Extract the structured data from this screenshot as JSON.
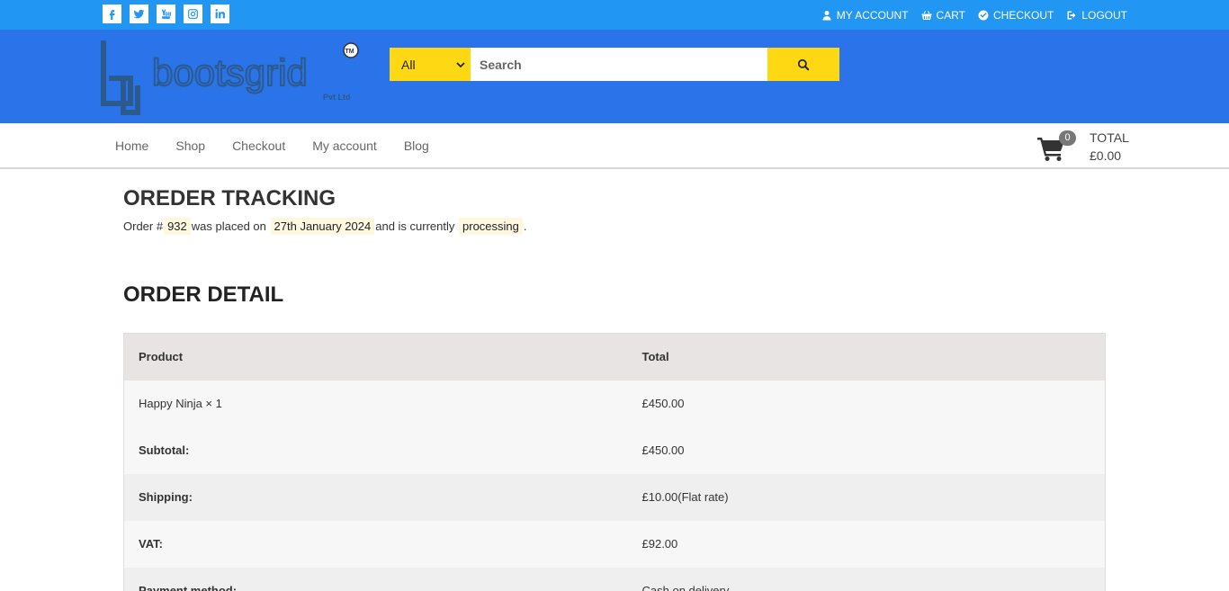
{
  "topbar": {
    "social": [
      "facebook-icon",
      "twitter-icon",
      "youtube-icon",
      "instagram-icon",
      "linkedin-icon"
    ],
    "links": [
      {
        "icon": "user-icon",
        "label": "MY ACCOUNT"
      },
      {
        "icon": "basket-icon",
        "label": "CART"
      },
      {
        "icon": "check-circle-icon",
        "label": "CHECKOUT"
      },
      {
        "icon": "logout-icon",
        "label": "LOGOUT"
      }
    ]
  },
  "header": {
    "logo_text": "bootsgrid",
    "logo_sub": "Pvt Ltd",
    "logo_tm": "TM",
    "search": {
      "category": "All",
      "placeholder": "Search"
    }
  },
  "nav": {
    "items": [
      "Home",
      "Shop",
      "Checkout",
      "My account",
      "Blog"
    ],
    "cart_count": "0",
    "total_label": "TOTAL",
    "total_value": "£0.00"
  },
  "page": {
    "title": "OREDER TRACKING",
    "order_prefix": "Order #",
    "order_number": "932",
    "placed_text": "was placed on",
    "order_date": "27th January 2024",
    "status_text": "and is currently",
    "status": "processing",
    "period": ".",
    "detail_title": "ORDER DETAIL"
  },
  "table": {
    "headers": [
      "Product",
      "Total"
    ],
    "rows": [
      {
        "label": "Happy Ninja × 1",
        "value": "£450.00"
      },
      {
        "label": "Subtotal:",
        "value": "£450.00"
      },
      {
        "label": "Shipping:",
        "value": "£10.00(Flat rate)"
      },
      {
        "label": "VAT:",
        "value": "£92.00"
      },
      {
        "label": "Payment method:",
        "value": "Cash on delivery"
      }
    ]
  },
  "colors": {
    "topbar": "#2196f3",
    "header": "#2a73e8",
    "accent_yellow": "#ffd814",
    "highlight": "#fff8e0",
    "table_header": "#e8e4e3"
  }
}
